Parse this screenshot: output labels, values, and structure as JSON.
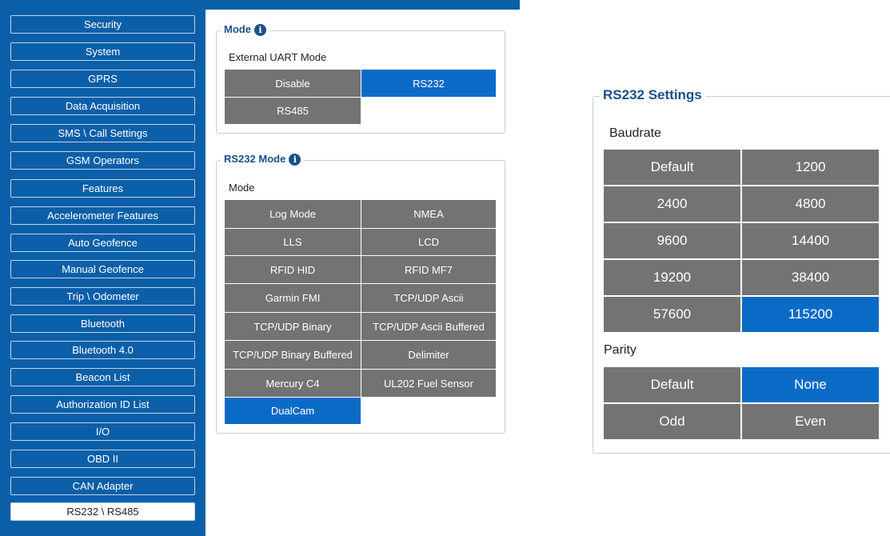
{
  "sidebar": {
    "items": [
      {
        "label": "Security"
      },
      {
        "label": "System"
      },
      {
        "label": "GPRS"
      },
      {
        "label": "Data Acquisition"
      },
      {
        "label": "SMS \\ Call Settings"
      },
      {
        "label": "GSM Operators"
      },
      {
        "label": "Features"
      },
      {
        "label": "Accelerometer Features"
      },
      {
        "label": "Auto Geofence"
      },
      {
        "label": "Manual Geofence"
      },
      {
        "label": "Trip \\ Odometer"
      },
      {
        "label": "Bluetooth"
      },
      {
        "label": "Bluetooth 4.0"
      },
      {
        "label": "Beacon List"
      },
      {
        "label": "Authorization ID List"
      },
      {
        "label": "I/O"
      },
      {
        "label": "OBD II"
      },
      {
        "label": "CAN Adapter"
      },
      {
        "label": "RS232 \\ RS485"
      }
    ],
    "active_label": "RS232 \\ RS485"
  },
  "mode_group": {
    "title": "Mode",
    "sublabel": "External UART Mode",
    "options": [
      {
        "label": "Disable"
      },
      {
        "label": "RS232"
      },
      {
        "label": "RS485"
      }
    ],
    "selected": "RS232"
  },
  "rs232_mode_group": {
    "title": "RS232 Mode",
    "sublabel": "Mode",
    "options": [
      {
        "label": "Log Mode"
      },
      {
        "label": "NMEA"
      },
      {
        "label": "LLS"
      },
      {
        "label": "LCD"
      },
      {
        "label": "RFID HID"
      },
      {
        "label": "RFID MF7"
      },
      {
        "label": "Garmin FMI"
      },
      {
        "label": "TCP/UDP Ascii"
      },
      {
        "label": "TCP/UDP Binary"
      },
      {
        "label": "TCP/UDP Ascii Buffered"
      },
      {
        "label": "TCP/UDP Binary Buffered"
      },
      {
        "label": "Delimiter"
      },
      {
        "label": "Mercury C4"
      },
      {
        "label": "UL202 Fuel Sensor"
      },
      {
        "label": "DualCam"
      }
    ],
    "selected": "DualCam"
  },
  "rs232_settings": {
    "title": "RS232 Settings",
    "baudrate_label": "Baudrate",
    "baudrate_options": [
      {
        "label": "Default"
      },
      {
        "label": "1200"
      },
      {
        "label": "2400"
      },
      {
        "label": "4800"
      },
      {
        "label": "9600"
      },
      {
        "label": "14400"
      },
      {
        "label": "19200"
      },
      {
        "label": "38400"
      },
      {
        "label": "57600"
      },
      {
        "label": "115200"
      }
    ],
    "baudrate_selected": "115200",
    "parity_label": "Parity",
    "parity_options": [
      {
        "label": "Default"
      },
      {
        "label": "None"
      },
      {
        "label": "Odd"
      },
      {
        "label": "Even"
      }
    ],
    "parity_selected": "None"
  },
  "colors": {
    "sidebar_bg": "#0a5fa8",
    "option_default": "#737373",
    "option_selected": "#0a6bc7",
    "legend_text": "#1b4f8a"
  },
  "icons": {
    "info": "info-icon"
  }
}
